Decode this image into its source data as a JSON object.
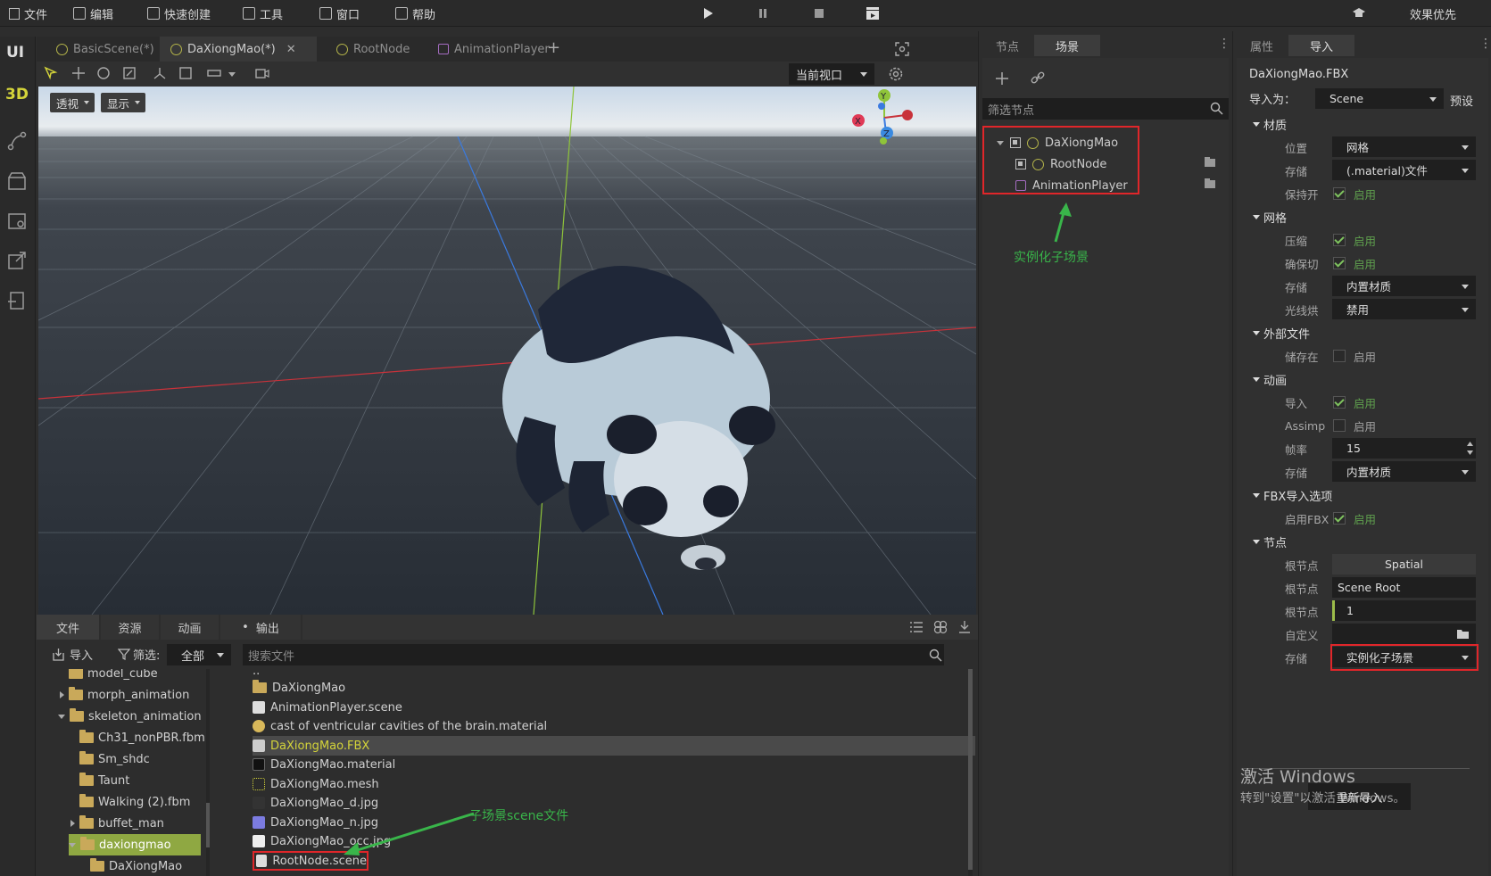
{
  "menubar": {
    "items": [
      "文件",
      "编辑",
      "快速创建",
      "工具",
      "窗口",
      "帮助"
    ],
    "quality": "效果优先"
  },
  "sidebar": {
    "ui": "UI",
    "threed": "3D"
  },
  "tabs": [
    {
      "label": "BasicScene(*)"
    },
    {
      "label": "DaXiongMao(*)"
    },
    {
      "label": "RootNode"
    },
    {
      "label": "AnimationPlayer"
    }
  ],
  "viewport": {
    "view_select": "当前视口",
    "perspective": "透视",
    "display": "显示",
    "gizmo": {
      "x": "X",
      "y": "Y",
      "z": "Z"
    }
  },
  "bottom": {
    "tabs": [
      "文件",
      "资源",
      "动画",
      "输出"
    ],
    "import": "导入",
    "filter": "筛选:",
    "filter_value": "全部",
    "search_placeholder": "搜索文件",
    "tree": [
      {
        "label": "model_cube"
      },
      {
        "label": "morph_animation"
      },
      {
        "label": "skeleton_animation"
      },
      {
        "label": "Ch31_nonPBR.fbm"
      },
      {
        "label": "Sm_shdc"
      },
      {
        "label": "Taunt"
      },
      {
        "label": "Walking (2).fbm"
      },
      {
        "label": "buffet_man"
      },
      {
        "label": "daxiongmao"
      },
      {
        "label": "DaXiongMao"
      }
    ],
    "files": [
      {
        "name": ".."
      },
      {
        "name": "DaXiongMao"
      },
      {
        "name": "AnimationPlayer.scene"
      },
      {
        "name": "cast of ventricular cavities of the brain.material"
      },
      {
        "name": "DaXiongMao.FBX"
      },
      {
        "name": "DaXiongMao.material"
      },
      {
        "name": "DaXiongMao.mesh"
      },
      {
        "name": "DaXiongMao_d.jpg"
      },
      {
        "name": "DaXiongMao_n.jpg"
      },
      {
        "name": "DaXiongMao_occ.jpg"
      },
      {
        "name": "RootNode.scene"
      }
    ],
    "annotation": "子场景scene文件"
  },
  "scene_panel": {
    "tabs": [
      "节点",
      "场景"
    ],
    "filter_placeholder": "筛选节点",
    "nodes": [
      "DaXiongMao",
      "RootNode",
      "AnimationPlayer"
    ],
    "annotation": "实例化子场景"
  },
  "prop_panel": {
    "tabs": [
      "属性",
      "导入"
    ],
    "filename": "DaXiongMao.FBX",
    "import_as_label": "导入为：",
    "import_as_value": "Scene",
    "preset": "预设",
    "sections": {
      "material": "材质",
      "mesh": "网格",
      "external": "外部文件",
      "animation": "动画",
      "fbx": "FBX导入选项",
      "node": "节点"
    },
    "rows": {
      "mat_pos_label": "位置",
      "mat_pos_value": "网格",
      "mat_store_label": "存储",
      "mat_store_value": "(.material)文件",
      "mat_keep_label": "保持开",
      "enable": "启用",
      "mesh_compress_label": "压缩",
      "mesh_tangent_label": "确保切",
      "mesh_store_label": "存储",
      "mesh_store_value": "内置材质",
      "mesh_light_label": "光线烘",
      "mesh_light_value": "禁用",
      "ext_store_label": "储存在",
      "anim_import_label": "导入",
      "anim_assimp_label": "Assimp",
      "anim_fps_label": "帧率",
      "anim_fps_value": "15",
      "anim_store_label": "存储",
      "anim_store_value": "内置材质",
      "fbx_enable_label": "启用FBX",
      "node_root_type_label": "根节点",
      "node_root_type_value": "Spatial",
      "node_root_name_label": "根节点",
      "node_root_name_value": "Scene Root",
      "node_root_scale_label": "根节点",
      "node_root_scale_value": "1",
      "node_custom_label": "自定义",
      "node_store_label": "存储",
      "node_store_value": "实例化子场景"
    },
    "reimport": "重新导入",
    "watermark_title": "激活 Windows",
    "watermark_sub": "转到\"设置\"以激活 Windows。"
  },
  "colors": {
    "accent": "#3c3c3c",
    "highlight": "#7fa03a",
    "annotation": "#e0262a",
    "annotation_text": "#39b54a"
  }
}
